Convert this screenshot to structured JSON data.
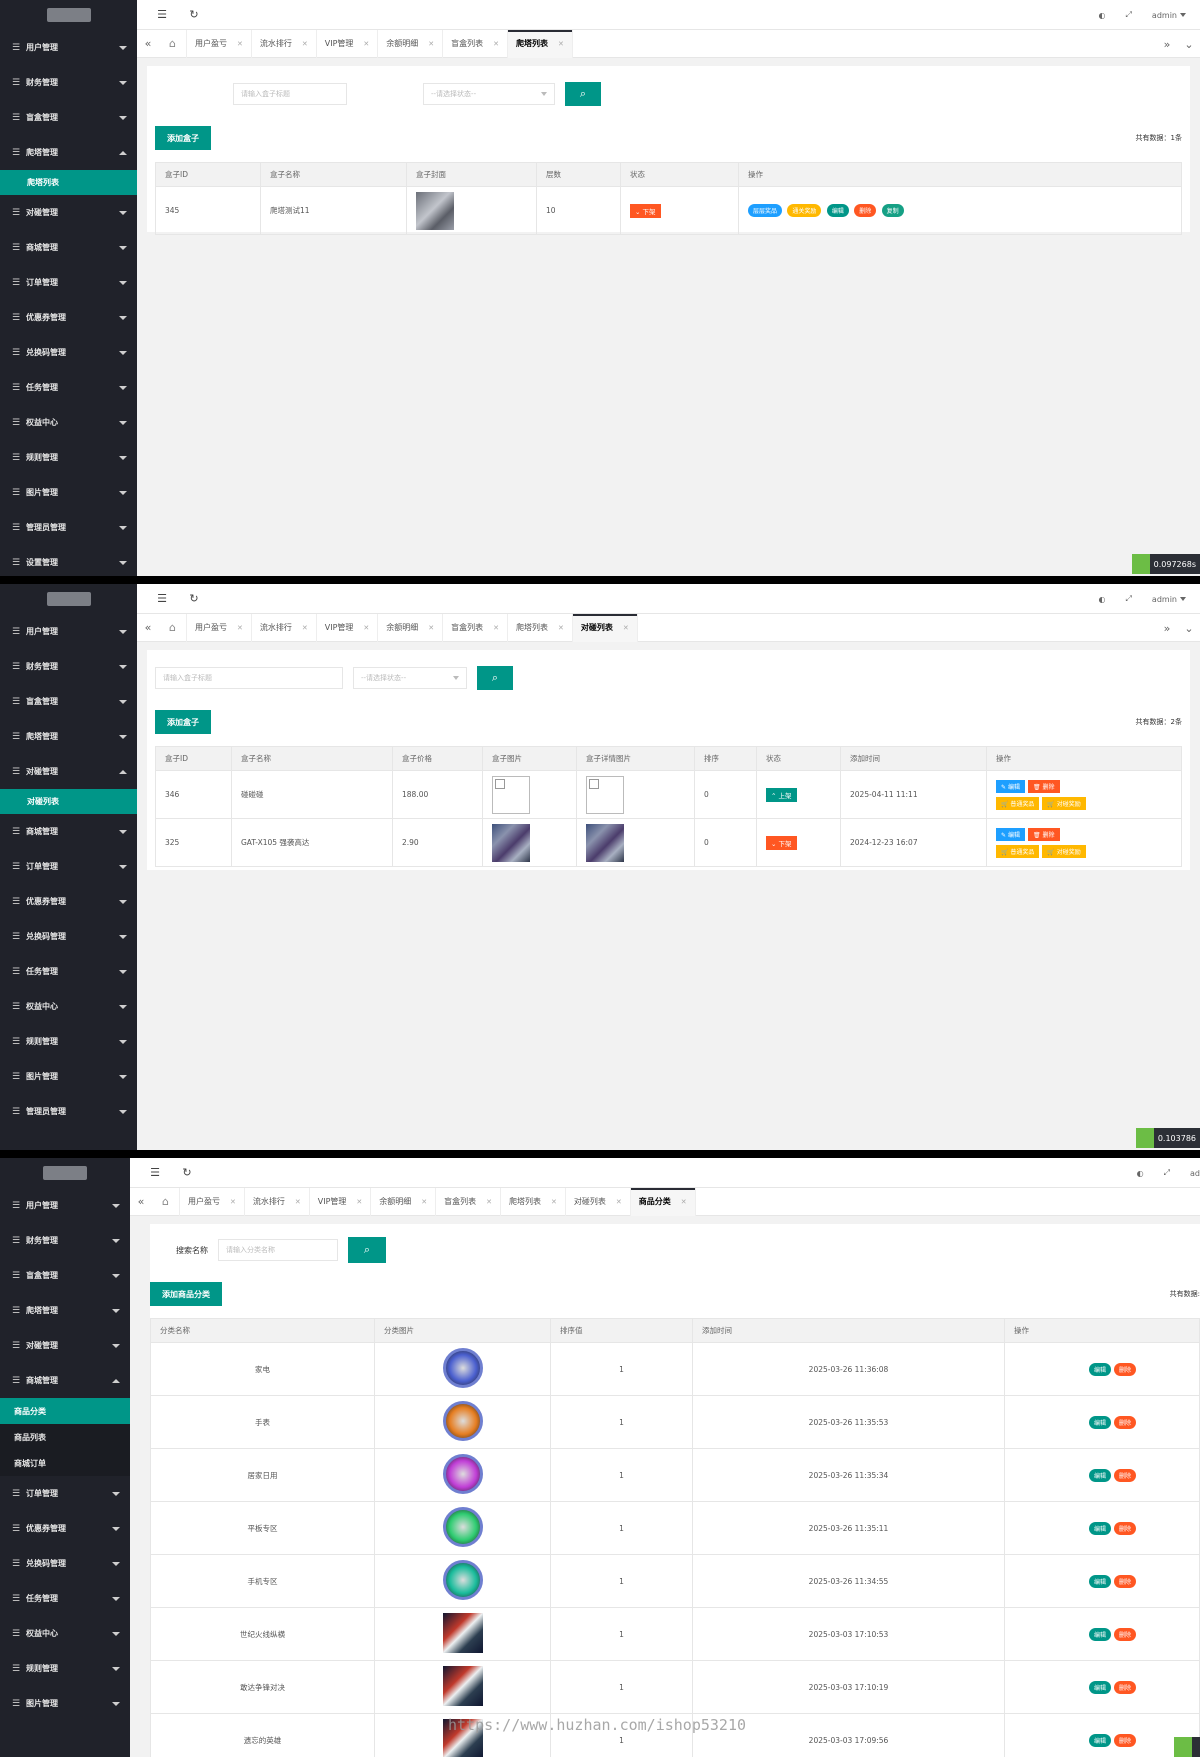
{
  "panel1": {
    "sidebar": [
      {
        "label": "用户管理",
        "expanded": false
      },
      {
        "label": "财务管理",
        "expanded": false
      },
      {
        "label": "盲盒管理",
        "expanded": false
      },
      {
        "label": "爬塔管理",
        "expanded": true,
        "children": [
          {
            "label": "爬塔列表",
            "active": true
          }
        ]
      },
      {
        "label": "对碰管理",
        "expanded": false
      },
      {
        "label": "商城管理",
        "expanded": false
      },
      {
        "label": "订单管理",
        "expanded": false
      },
      {
        "label": "优惠券管理",
        "expanded": false
      },
      {
        "label": "兑换码管理",
        "expanded": false
      },
      {
        "label": "任务管理",
        "expanded": false
      },
      {
        "label": "权益中心",
        "expanded": false
      },
      {
        "label": "规则管理",
        "expanded": false
      },
      {
        "label": "图片管理",
        "expanded": false
      },
      {
        "label": "管理员管理",
        "expanded": false
      },
      {
        "label": "设置管理",
        "expanded": false
      }
    ],
    "user": "admin",
    "tabs": [
      "用户盈亏",
      "流水排行",
      "VIP管理",
      "余额明细",
      "盲盒列表",
      "爬塔列表"
    ],
    "active_tab": "爬塔列表",
    "search_placeholder": "请输入盒子标题",
    "select_placeholder": "--请选择状态--",
    "add_button": "添加盒子",
    "total": "共有数据：1条",
    "columns": [
      "盒子ID",
      "盒子名称",
      "盒子封面",
      "层数",
      "状态",
      "操作"
    ],
    "rows": [
      {
        "id": "345",
        "name": "爬塔测试11",
        "layers": "10",
        "status": "下架",
        "ops": [
          "层层奖品",
          "通关奖励",
          "编辑",
          "删除",
          "复制"
        ]
      }
    ],
    "timer": "0.097268s"
  },
  "panel2": {
    "sidebar": [
      {
        "label": "用户管理",
        "expanded": false
      },
      {
        "label": "财务管理",
        "expanded": false
      },
      {
        "label": "盲盒管理",
        "expanded": false
      },
      {
        "label": "爬塔管理",
        "expanded": false
      },
      {
        "label": "对碰管理",
        "expanded": true,
        "children": [
          {
            "label": "对碰列表",
            "active": true
          }
        ]
      },
      {
        "label": "商城管理",
        "expanded": false
      },
      {
        "label": "订单管理",
        "expanded": false
      },
      {
        "label": "优惠券管理",
        "expanded": false
      },
      {
        "label": "兑换码管理",
        "expanded": false
      },
      {
        "label": "任务管理",
        "expanded": false
      },
      {
        "label": "权益中心",
        "expanded": false
      },
      {
        "label": "规则管理",
        "expanded": false
      },
      {
        "label": "图片管理",
        "expanded": false
      },
      {
        "label": "管理员管理",
        "expanded": false
      }
    ],
    "user": "admin",
    "tabs": [
      "用户盈亏",
      "流水排行",
      "VIP管理",
      "余额明细",
      "盲盒列表",
      "爬塔列表",
      "对碰列表"
    ],
    "active_tab": "对碰列表",
    "search_placeholder": "请输入盒子标题",
    "select_placeholder": "--请选择状态--",
    "add_button": "添加盒子",
    "total": "共有数据：2条",
    "columns": [
      "盒子ID",
      "盒子名称",
      "盒子价格",
      "盒子图片",
      "盒子详情图片",
      "排序",
      "状态",
      "添加时间",
      "操作"
    ],
    "rows": [
      {
        "id": "346",
        "name": "碰碰碰",
        "price": "188.00",
        "sort": "0",
        "status": "上架",
        "time": "2025-04-11 11:11",
        "img": "broken",
        "ops": [
          "编辑",
          "删除",
          "普通奖品",
          "对碰奖励"
        ]
      },
      {
        "id": "325",
        "name": "GAT-X105 强袭高达",
        "price": "2.90",
        "sort": "0",
        "status": "下架",
        "time": "2024-12-23 16:07",
        "img": "gundam",
        "ops": [
          "编辑",
          "删除",
          "普通奖品",
          "对碰奖励"
        ]
      }
    ],
    "timer": "0.103786"
  },
  "panel3": {
    "sidebar": [
      {
        "label": "用户管理",
        "expanded": false
      },
      {
        "label": "财务管理",
        "expanded": false
      },
      {
        "label": "盲盒管理",
        "expanded": false
      },
      {
        "label": "爬塔管理",
        "expanded": false
      },
      {
        "label": "对碰管理",
        "expanded": false
      },
      {
        "label": "商城管理",
        "expanded": true,
        "children": [
          {
            "label": "商品分类",
            "active": true
          },
          {
            "label": "商品列表",
            "active": false
          },
          {
            "label": "商城订单",
            "active": false
          }
        ]
      },
      {
        "label": "订单管理",
        "expanded": false
      },
      {
        "label": "优惠券管理",
        "expanded": false
      },
      {
        "label": "兑换码管理",
        "expanded": false
      },
      {
        "label": "任务管理",
        "expanded": false
      },
      {
        "label": "权益中心",
        "expanded": false
      },
      {
        "label": "规则管理",
        "expanded": false
      },
      {
        "label": "图片管理",
        "expanded": false
      }
    ],
    "user": "ad",
    "tabs": [
      "用户盈亏",
      "流水排行",
      "VIP管理",
      "余额明细",
      "盲盒列表",
      "爬塔列表",
      "对碰列表",
      "商品分类"
    ],
    "active_tab": "商品分类",
    "search_label": "搜索名称",
    "search_placeholder": "请输入分类名称",
    "add_button": "添加商品分类",
    "total": "共有数据:",
    "columns": [
      "分类名称",
      "分类图片",
      "排序值",
      "添加时间",
      "操作"
    ],
    "rows": [
      {
        "name": "家电",
        "sort": "1",
        "time": "2025-03-26 11:36:08",
        "img": "circle",
        "color": "#4a5fcf"
      },
      {
        "name": "手表",
        "sort": "1",
        "time": "2025-03-26 11:35:53",
        "img": "circle",
        "color": "#e67e22"
      },
      {
        "name": "居家日用",
        "sort": "1",
        "time": "2025-03-26 11:35:34",
        "img": "circle",
        "color": "#c03ed6"
      },
      {
        "name": "平板专区",
        "sort": "1",
        "time": "2025-03-26 11:35:11",
        "img": "circle",
        "color": "#2ecc71"
      },
      {
        "name": "手机专区",
        "sort": "1",
        "time": "2025-03-26 11:34:55",
        "img": "circle",
        "color": "#1abc9c"
      },
      {
        "name": "世纪火线纵横",
        "sort": "1",
        "time": "2025-03-03 17:10:53",
        "img": "square",
        "color": "#c0392b"
      },
      {
        "name": "敢达争锋对决",
        "sort": "1",
        "time": "2025-03-03 17:10:19",
        "img": "square",
        "color": "#2c3e9e"
      },
      {
        "name": "遗忘的英雄",
        "sort": "1",
        "time": "2025-03-03 17:09:56",
        "img": "square",
        "color": "#555555"
      }
    ],
    "ops": [
      "编辑",
      "删除"
    ]
  },
  "watermark": "https://www.huzhan.com/ishop53210",
  "colors": {
    "primary": "#009688",
    "danger": "#ff5722",
    "warn": "#ffb800",
    "info": "#1e9fff",
    "sidebar": "#20222a"
  }
}
